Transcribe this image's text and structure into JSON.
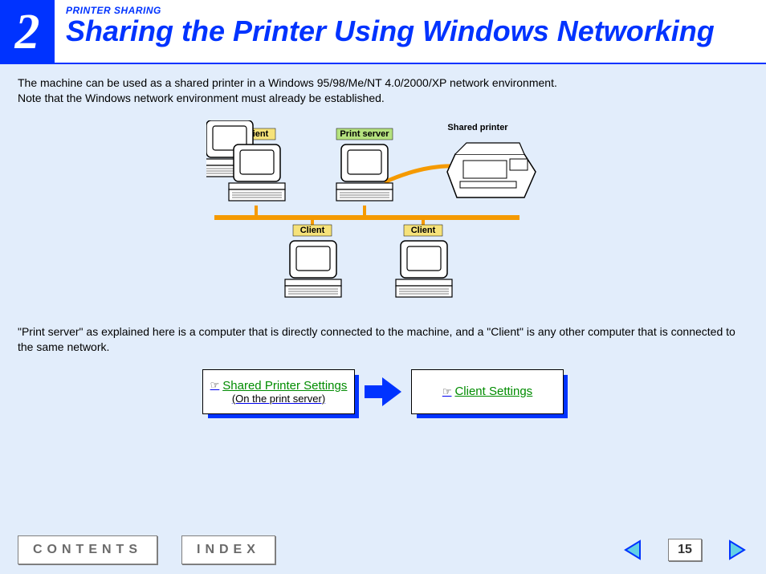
{
  "header": {
    "chapter_number": "2",
    "kicker": "PRINTER SHARING",
    "title": "Sharing the Printer Using Windows Networking"
  },
  "body": {
    "intro_paragraph": "The machine can be used as a shared printer in a Windows 95/98/Me/NT 4.0/2000/XP network environment.\nNote that the Windows network environment must already be established.",
    "explain_paragraph": "\"Print server\" as explained here is a computer that is directly connected to the machine, and a \"Client\" is any other computer that is connected to the same network."
  },
  "diagram": {
    "top_left_label": "Client",
    "top_mid_label": "Print server",
    "top_right_label": "Shared printer",
    "bottom_left_label": "Client",
    "bottom_right_label": "Client"
  },
  "link_cards": {
    "left": {
      "label": "Shared Printer Settings",
      "sub": "(On the print server)"
    },
    "right": {
      "label": "Client Settings"
    }
  },
  "footer": {
    "contents": "CONTENTS",
    "index": "INDEX",
    "page_number": "15"
  }
}
